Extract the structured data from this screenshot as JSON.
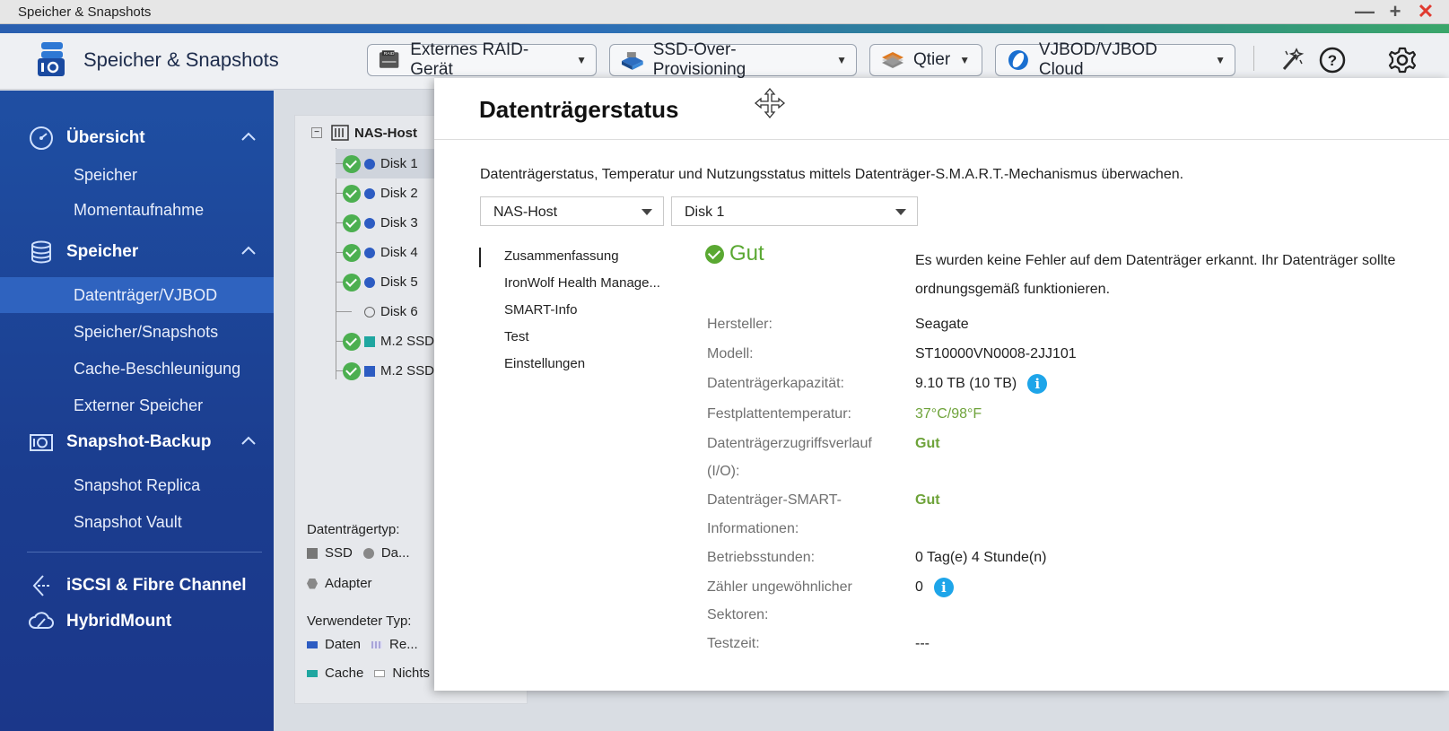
{
  "window": {
    "title": "Speicher & Snapshots",
    "controls": {
      "minimize": "—",
      "maximize": "+",
      "close": "✕"
    }
  },
  "header": {
    "app_title": "Speicher & Snapshots",
    "buttons": [
      {
        "label": "Externes RAID-Gerät",
        "icon": "raid-device-icon"
      },
      {
        "label": "SSD-Over-Provisioning",
        "icon": "ssd-icon"
      },
      {
        "label": "Qtier",
        "icon": "qtier-icon"
      },
      {
        "label": "VJBOD/VJBOD Cloud",
        "icon": "vjbod-cloud-icon"
      }
    ],
    "right_icons": [
      "magic-wand-icon",
      "help-icon",
      "gear-icon"
    ]
  },
  "sidebar": {
    "sections": [
      {
        "label": "Übersicht",
        "icon": "dashboard-icon",
        "items": [
          "Speicher",
          "Momentaufnahme"
        ]
      },
      {
        "label": "Speicher",
        "icon": "database-icon",
        "items": [
          "Datenträger/VJBOD",
          "Speicher/Snapshots",
          "Cache-Beschleunigung",
          "Externer Speicher"
        ],
        "active_item": "Datenträger/VJBOD"
      },
      {
        "label": "Snapshot-Backup",
        "icon": "camera-icon",
        "items": [
          "Snapshot Replica",
          "Snapshot Vault"
        ]
      }
    ],
    "extra": [
      {
        "label": "iSCSI & Fibre Channel",
        "icon": "iscsi-icon"
      },
      {
        "label": "HybridMount",
        "icon": "cloud-mount-icon"
      }
    ]
  },
  "tree": {
    "root": "NAS-Host",
    "items": [
      {
        "label": "Disk 1",
        "ok": true,
        "type": "data",
        "color": "#2d5cc2"
      },
      {
        "label": "Disk 2",
        "ok": true,
        "type": "data",
        "color": "#2d5cc2"
      },
      {
        "label": "Disk 3",
        "ok": true,
        "type": "data",
        "color": "#2d5cc2"
      },
      {
        "label": "Disk 4",
        "ok": true,
        "type": "data",
        "color": "#2d5cc2"
      },
      {
        "label": "Disk 5",
        "ok": true,
        "type": "data",
        "color": "#2d5cc2"
      },
      {
        "label": "Disk 6",
        "ok": false,
        "type": "empty",
        "color": ""
      },
      {
        "label": "M.2 SSD",
        "ok": true,
        "type": "cache",
        "color": "#1fa6a0"
      },
      {
        "label": "M.2 SSD",
        "ok": true,
        "type": "data-ssd",
        "color": "#2d5cc2"
      }
    ]
  },
  "legend": {
    "type_heading": "Datenträgertyp:",
    "ssd": "SSD",
    "hdd": "Da...",
    "adapter": "Adapter",
    "used_heading": "Verwendeter Typ:",
    "data": "Daten",
    "reserved": "Re...",
    "cache": "Cache",
    "none": "Nichts"
  },
  "dialog": {
    "title": "Datenträgerstatus",
    "description": "Datenträgerstatus, Temperatur und Nutzungsstatus mittels Datenträger-S.M.A.R.T.-Mechanismus überwachen.",
    "host_select": "NAS-Host",
    "disk_select": "Disk 1",
    "nav": [
      "Zusammenfassung",
      "IronWolf Health Manage...",
      "SMART-Info",
      "Test",
      "Einstellungen"
    ],
    "status": "Gut",
    "status_message": "Es wurden keine Fehler auf dem Datenträger erkannt. Ihr Datenträger sollte ordnungsgemäß funktionieren.",
    "fields": {
      "manufacturer_label": "Hersteller:",
      "manufacturer": "Seagate",
      "model_label": "Modell:",
      "model": "ST10000VN0008-2JJ101",
      "capacity_label": "Datenträgerkapazität:",
      "capacity": "9.10 TB (10 TB)",
      "temp_label": "Festplattentemperatur:",
      "temp": "37°C/98°F",
      "access_label_1": "Datenträgerzugriffsverlauf",
      "access_label_2": "(I/O):",
      "access": "Gut",
      "smart_label_1": "Datenträger-SMART-",
      "smart_label_2": "Informationen:",
      "smart": "Gut",
      "hours_label": "Betriebsstunden:",
      "hours": "0 Tag(e) 4 Stunde(n)",
      "sectors_label_1": "Zähler ungewöhnlicher",
      "sectors_label_2": "Sektoren:",
      "sectors": "0",
      "testtime_label": "Testzeit:",
      "testtime": "---"
    }
  }
}
